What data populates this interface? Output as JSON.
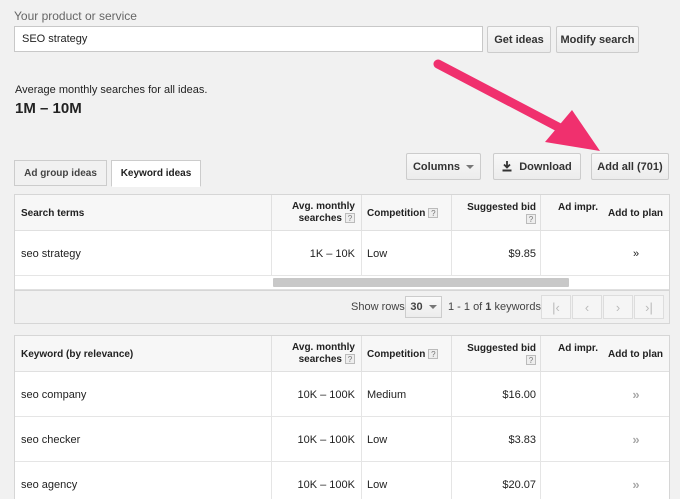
{
  "search": {
    "label": "Your product or service",
    "value": "SEO strategy",
    "get_ideas": "Get ideas",
    "modify": "Modify search"
  },
  "summary": {
    "label": "Average monthly searches for all ideas.",
    "value": "1M – 10M"
  },
  "tabs": [
    {
      "label": "Ad group ideas"
    },
    {
      "label": "Keyword ideas"
    }
  ],
  "toolbar": {
    "columns": "Columns",
    "download": "Download",
    "add_all": "Add all (701)"
  },
  "search_terms_table": {
    "headers": [
      "Search terms",
      "Avg. monthly",
      "searches",
      "Competition",
      "Suggested bid",
      "Ad impr.",
      "Add to plan"
    ],
    "rows": [
      {
        "term": "seo strategy",
        "searches": "1K – 10K",
        "competition": "Low",
        "bid": "$9.85"
      }
    ]
  },
  "pager": {
    "label": "Show rows:",
    "rows": "30",
    "count_prefix": "1 - 1 of ",
    "count_total": "1",
    "count_suffix": " keywords"
  },
  "keyword_table": {
    "headers": [
      "Keyword (by relevance)",
      "Avg. monthly",
      "searches",
      "Competition",
      "Suggested bid",
      "Ad impr.",
      "Add to plan"
    ],
    "rows": [
      {
        "term": "seo company",
        "searches": "10K – 100K",
        "competition": "Medium",
        "bid": "$16.00"
      },
      {
        "term": "seo checker",
        "searches": "10K – 100K",
        "competition": "Low",
        "bid": "$3.83"
      },
      {
        "term": "seo agency",
        "searches": "10K – 100K",
        "competition": "Low",
        "bid": "$20.07"
      }
    ]
  },
  "icons": {
    "help": "?",
    "chevron": "»",
    "download": "download-icon"
  },
  "colors": {
    "annotation_arrow": "#f0306e"
  }
}
